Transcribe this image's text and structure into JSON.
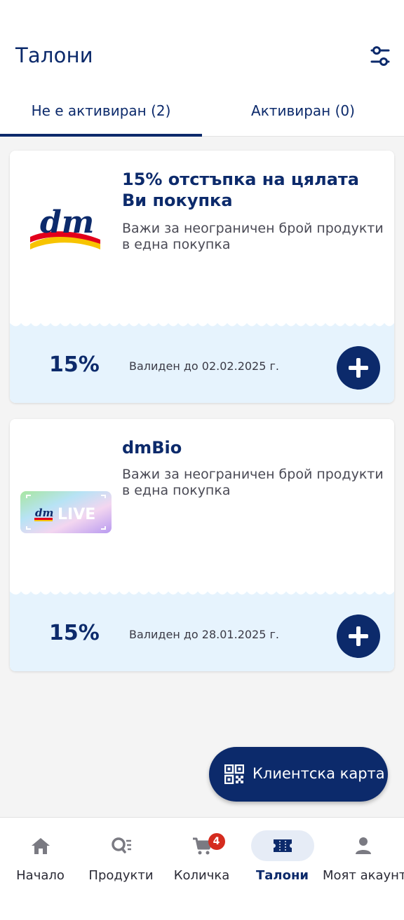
{
  "header": {
    "title": "Талони",
    "filter_icon": "sliders-icon"
  },
  "tabs": [
    {
      "label": "Не е активиран (2)",
      "active": true
    },
    {
      "label": "Активиран (0)",
      "active": false
    }
  ],
  "coupons": [
    {
      "title": "15% отстъпка на цялата Ви покупка",
      "description": "Важи за неограничен брой продукти в една покупка",
      "discount": "15%",
      "validity": "Валиден до 02.02.2025 г.",
      "logo": "dm",
      "action_icon": "plus-icon"
    },
    {
      "title": "dmBio",
      "description": "Важи за неограничен брой продукти в една покупка",
      "discount": "15%",
      "validity": "Валиден до 28.01.2025 г.",
      "logo": "dm LIVE",
      "action_icon": "plus-icon"
    }
  ],
  "fab": {
    "label": "Клиентска карта",
    "icon": "qr-code-icon"
  },
  "bottom_nav": [
    {
      "label": "Начало",
      "icon": "home-icon",
      "active": false
    },
    {
      "label": "Продукти",
      "icon": "search-list-icon",
      "active": false
    },
    {
      "label": "Количка",
      "icon": "cart-icon",
      "active": false,
      "badge": "4"
    },
    {
      "label": "Талони",
      "icon": "ticket-icon",
      "active": true
    },
    {
      "label": "Моят акаунт",
      "icon": "user-icon",
      "active": false
    }
  ],
  "colors": {
    "brand_navy": "#0c2a6b",
    "coupon_bottom": "#e6f3fd",
    "badge_red": "#d52b1e",
    "logo_yellow": "#f7c400",
    "logo_red": "#e3001b"
  }
}
